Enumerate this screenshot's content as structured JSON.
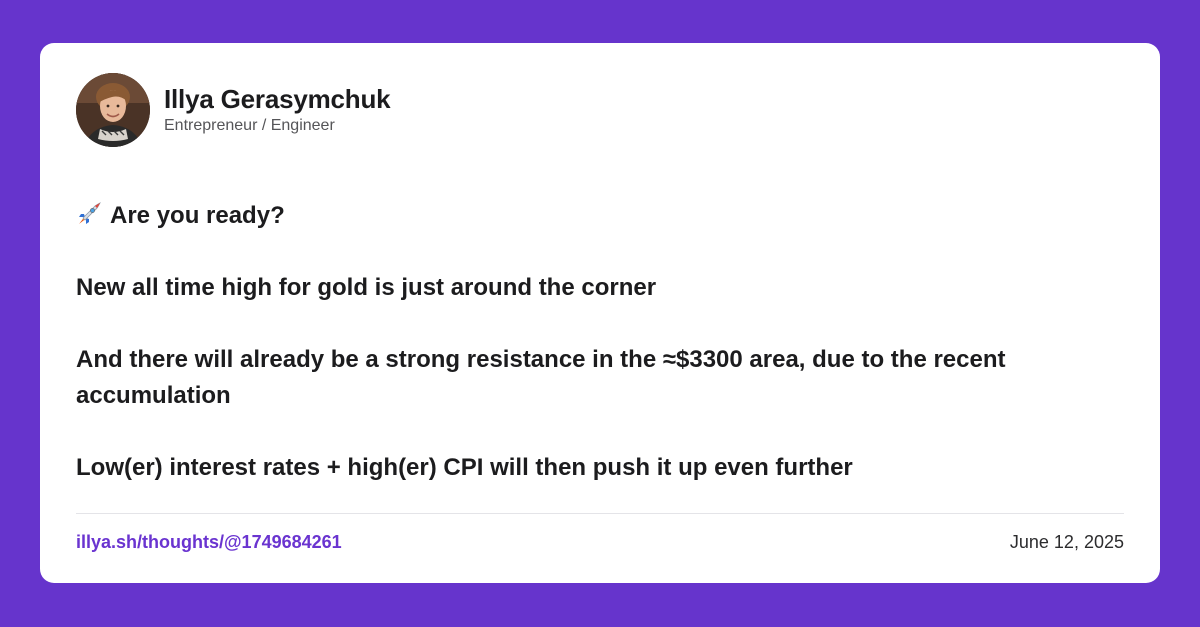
{
  "author": {
    "name": "Illya Gerasymchuk",
    "role": "Entrepreneur / Engineer"
  },
  "post": {
    "line1": "Are you ready?",
    "line2": "New all time high for gold is just around the corner",
    "line3": "And there will already be a strong resistance in the ≈$3300 area, due to the recent accumulation",
    "line4": "Low(er) interest rates + high(er) CPI will then push it up even further",
    "leading_icon": "rocket-icon"
  },
  "footer": {
    "link": "illya.sh/thoughts/@1749684261",
    "date": "June 12, 2025"
  },
  "colors": {
    "background": "#6634cc",
    "card": "#ffffff",
    "link": "#6a34d0"
  }
}
